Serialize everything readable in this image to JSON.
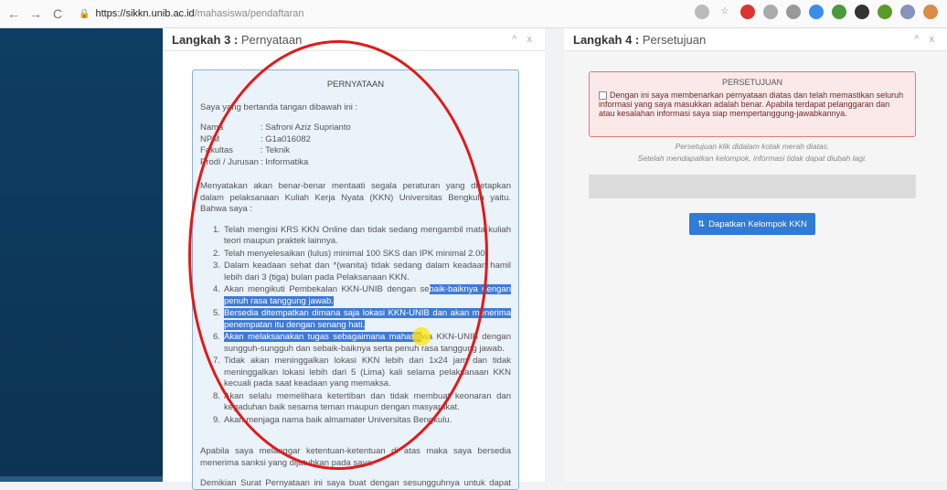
{
  "browser": {
    "url_host": "https://sikkn.unib.ac.id",
    "url_path": "/mahasiswa/pendaftaran"
  },
  "step3": {
    "title_bold": "Langkah 3 :",
    "title_rest": " Pernyataan",
    "controls": "^ x",
    "heading": "PERNYATAAN",
    "intro": "Saya yang bertanda tangan dibawah ini :",
    "identity": [
      {
        "key": "Nama",
        "value": ": Safroni Aziz Suprianto"
      },
      {
        "key": "NPM",
        "value": ": G1a016082"
      },
      {
        "key": "Fakultas",
        "value": ": Teknik"
      },
      {
        "key": "Prodi / Jurusan",
        "value": ": Informatika"
      }
    ],
    "declaration": "Menyatakan akan benar-benar mentaati segala peraturan yang ditetapkan dalam pelaksanaan Kuliah Kerja Nyata (KKN) Universitas Bengkulu yaitu. Bahwa saya :",
    "items": [
      {
        "n": "1.",
        "text": "Telah mengisi KRS KKN Online dan tidak sedang mengambil mata kuliah teori maupun praktek lainnya.",
        "pre": "",
        "hl": "",
        "post": ""
      },
      {
        "n": "2.",
        "text": "Telah menyelesaikan (lulus) minimal 100 SKS dan IPK minimal 2.00.",
        "pre": "",
        "hl": "",
        "post": ""
      },
      {
        "n": "3.",
        "text": "Dalam keadaan sehat dan *(wanita) tidak sedang dalam keadaan hamil lebih dari 3 (tiga) bulan pada Pelaksanaan KKN.",
        "pre": "",
        "hl": "",
        "post": ""
      },
      {
        "n": "4.",
        "pre": "Akan mengikuti Pembekalan KKN-UNIB dengan se",
        "hl": "baik-baiknya dengan penuh rasa tanggung jawab.",
        "post": ""
      },
      {
        "n": "5.",
        "pre": "",
        "hl": "Bersedia ditempatkan dimana saja lokasi KKN-UNIB dan akan menerima penempatan itu dengan senang hati.",
        "post": ""
      },
      {
        "n": "6.",
        "pre": "",
        "hl": "Akan melaksanakan tugas sebagaimana mahasis",
        "post": "wa KKN-UNIB dengan sungguh-sungguh dan sebaik-baiknya serta penuh rasa tanggung jawab."
      },
      {
        "n": "7.",
        "text": "Tidak akan meninggalkan lokasi KKN lebih dari 1x24 jam dan tidak meninggalkan lokasi lebih dari 5 (Lima) kali selama pelaksanaan KKN kecuali pada saat keadaan yang memaksa.",
        "pre": "",
        "hl": "",
        "post": ""
      },
      {
        "n": "8.",
        "text": "Akan selalu memelihara ketertiban dan tidak membuat keonaran dan kegaduhan baik sesama teman maupun dengan masyarakat.",
        "pre": "",
        "hl": "",
        "post": ""
      },
      {
        "n": "9.",
        "text": "Akan menjaga nama baik almamater Universitas Bengkulu.",
        "pre": "",
        "hl": "",
        "post": ""
      }
    ],
    "closing": "Apabila saya melanggar ketentuan-ketentuan di atas maka saya bersedia menerima sanksi yang dijatuhkan pada saya.",
    "final": "Demikian Surat Pernyataan ini saya buat dengan sesungguhnya untuk dapat dipergunakan sebagaimana mestinya."
  },
  "step4": {
    "title_bold": "Langkah 4 :",
    "title_rest": " Persetujuan",
    "controls": "^ x",
    "consent_title": "PERSETUJUAN",
    "consent_text": "Dengan ini saya membenarkan pernyataan diatas dan telah memastikan seluruh informasi yang saya masukkan adalah benar. Apabila terdapat pelanggaran dan atau kesalahan informasi saya siap mempertanggung-jawabkannya.",
    "note1": "Persetujuan klik didalam kotak merah diatas.",
    "note2": "Setelah mendapatkan kelompok, informasi tidak dapat diubah lagi.",
    "button_label": "Dapatkan Kelompok KKN"
  },
  "colors": {
    "annotation": "#e21919",
    "button": "#2f7bd6",
    "sidebar": "#0e3e63"
  }
}
